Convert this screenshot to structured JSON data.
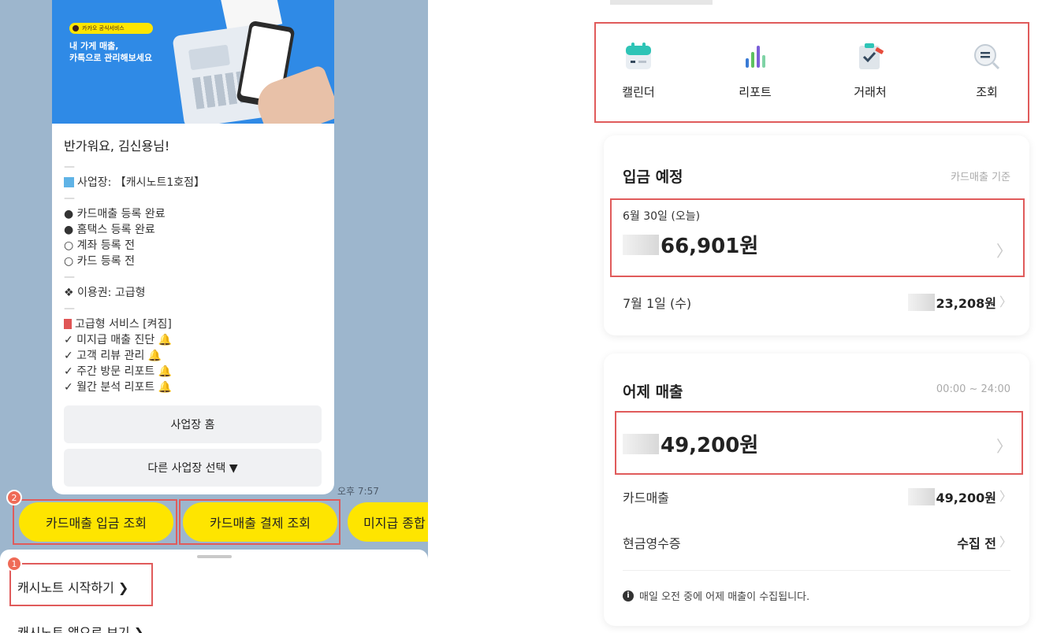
{
  "chat": {
    "banner_pill": "카카오 공식서비스",
    "banner_text": "내 가게 매출,\n카톡으로 관리해보세요",
    "greeting": "반가워요, 김신용님!",
    "dash": "—",
    "business_line": "사업장: 【캐시노트1호점】",
    "status_lines": [
      "● 카드매출 등록 완료",
      "● 홈택스 등록 완료",
      "○ 계좌 등록 전",
      "○ 카드 등록 전"
    ],
    "pass_line": "❖ 이용권: 고급형",
    "premium_line": "고급형 서비스 [켜짐]",
    "feature_lines": [
      "✓ 미지급 매출 진단",
      "✓ 고객 리뷰 관리",
      "✓ 주간 방문 리포트",
      "✓ 월간 분석 리포트"
    ],
    "bell": "🔔",
    "btn_home": "사업장 홈",
    "btn_other": "다른 사업장 선택 ▼",
    "time": "오후 7:57",
    "quick_replies": [
      "카드매출 입금 조회",
      "카드매출 결제 조회",
      "미지급 종합"
    ],
    "badge1": "1",
    "badge2": "2",
    "sheet_items": [
      "캐시노트 시작하기 ❯",
      "캐시노트 앱으로 보기 ❯"
    ]
  },
  "app": {
    "icons": [
      {
        "label": "캘린더",
        "icon": "calendar-icon"
      },
      {
        "label": "리포트",
        "icon": "report-icon"
      },
      {
        "label": "거래처",
        "icon": "clipboard-icon"
      },
      {
        "label": "조회",
        "icon": "search-icon"
      }
    ],
    "deposit": {
      "title": "입금 예정",
      "note": "카드매출 기준",
      "today_date": "6월 30일 (오늘)",
      "today_amount": "66,901원",
      "next_date": "7월 1일 (수)",
      "next_amount": "23,208원"
    },
    "yesterday": {
      "title": "어제 매출",
      "note": "00:00 ~ 24:00",
      "amount": "49,200원",
      "card_label": "카드매출",
      "card_amount": "49,200원",
      "cash_label": "현금영수증",
      "cash_value": "수집 전",
      "info": "매일 오전 중에 어제 매출이 수집됩니다."
    },
    "chevron": "〉"
  },
  "colors": {
    "kakao_yellow": "#fee500",
    "chat_bg": "#9db6cd",
    "highlight_red": "#e05b5b"
  }
}
